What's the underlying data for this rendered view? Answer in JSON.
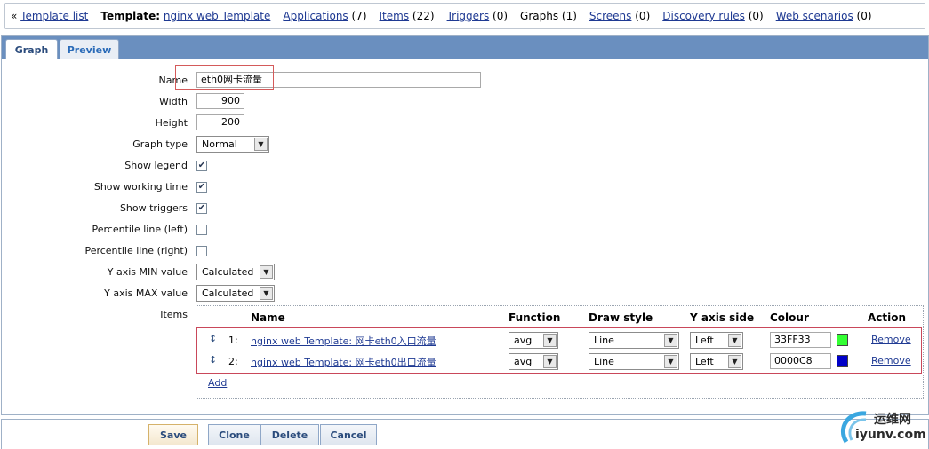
{
  "nav": {
    "template_list": "Template list",
    "template_label": "Template:",
    "template_name": "nginx web Template",
    "applications": "Applications",
    "applications_count": "(7)",
    "items": "Items",
    "items_count": "(22)",
    "triggers": "Triggers",
    "triggers_count": "(0)",
    "graphs": "Graphs (1)",
    "screens": "Screens",
    "screens_count": "(0)",
    "discovery": "Discovery rules",
    "discovery_count": "(0)",
    "web": "Web scenarios",
    "web_count": "(0)"
  },
  "tabs": {
    "graph": "Graph",
    "preview": "Preview"
  },
  "form": {
    "name_label": "Name",
    "name_value": "eth0网卡流量",
    "width_label": "Width",
    "width_value": "900",
    "height_label": "Height",
    "height_value": "200",
    "graph_type_label": "Graph type",
    "graph_type_value": "Normal",
    "show_legend_label": "Show legend",
    "show_working_time_label": "Show working time",
    "show_triggers_label": "Show triggers",
    "percentile_left_label": "Percentile line (left)",
    "percentile_right_label": "Percentile line (right)",
    "ymin_label": "Y axis MIN value",
    "ymin_value": "Calculated",
    "ymax_label": "Y axis MAX value",
    "ymax_value": "Calculated",
    "items_label": "Items"
  },
  "checkboxes": {
    "show_legend": true,
    "show_working_time": true,
    "show_triggers": true,
    "percentile_left": false,
    "percentile_right": false
  },
  "items_table": {
    "headers": {
      "name": "Name",
      "function": "Function",
      "draw_style": "Draw style",
      "y_axis_side": "Y axis side",
      "colour": "Colour",
      "action": "Action"
    },
    "rows": [
      {
        "num": "1:",
        "name": "nginx web Template: 网卡eth0入口流量",
        "function": "avg",
        "draw_style": "Line",
        "y_axis_side": "Left",
        "colour": "33FF33",
        "swatch": "#33FF33",
        "action": "Remove"
      },
      {
        "num": "2:",
        "name": "nginx web Template: 网卡eth0出口流量",
        "function": "avg",
        "draw_style": "Line",
        "y_axis_side": "Left",
        "colour": "0000C8",
        "swatch": "#0000C8",
        "action": "Remove"
      }
    ],
    "add": "Add"
  },
  "buttons": {
    "save": "Save",
    "clone": "Clone",
    "delete": "Delete",
    "cancel": "Cancel"
  },
  "watermark": {
    "cn": "运维网",
    "en": "iyunv.com"
  }
}
